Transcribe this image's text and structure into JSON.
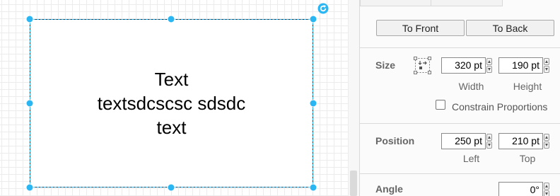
{
  "canvas": {
    "shape_text": {
      "line1": "Text",
      "line2": "textsdcscsc sdsdc",
      "line3": "text"
    },
    "selection_color": "#29b6f2"
  },
  "panel": {
    "buttons": {
      "to_front": "To Front",
      "to_back": "To Back"
    },
    "size": {
      "title": "Size",
      "width_value": "320 pt",
      "height_value": "190 pt",
      "width_label": "Width",
      "height_label": "Height",
      "constrain_label": "Constrain Proportions",
      "constrain_checked": false
    },
    "position": {
      "title": "Position",
      "left_value": "250 pt",
      "top_value": "210 pt",
      "left_label": "Left",
      "top_label": "Top"
    },
    "angle": {
      "title": "Angle",
      "value": "0°"
    }
  }
}
